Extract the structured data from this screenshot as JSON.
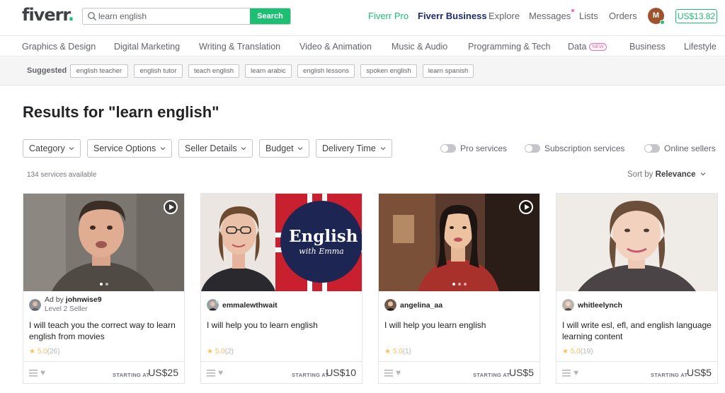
{
  "header": {
    "logo": "fiverr",
    "logo_dot": ".",
    "search_value": "learn english",
    "search_button": "Search",
    "nav": [
      "Fiverr Pro",
      "Fiverr Business",
      "Explore",
      "Messages",
      "Lists",
      "Orders"
    ],
    "avatar_initial": "M",
    "balance": "US$13.82"
  },
  "categories": [
    "Graphics & Design",
    "Digital Marketing",
    "Writing & Translation",
    "Video & Animation",
    "Music & Audio",
    "Programming & Tech",
    "Data",
    "Business",
    "Lifestyle"
  ],
  "new_badge": "NEW",
  "suggested": {
    "label": "Suggested",
    "tags": [
      "english teacher",
      "english tutor",
      "teach english",
      "learn arabic",
      "english lessons",
      "spoken english",
      "learn spanish"
    ]
  },
  "results_title": "Results for \"learn english\"",
  "filters": [
    "Category",
    "Service Options",
    "Seller Details",
    "Budget",
    "Delivery Time"
  ],
  "toggles": [
    "Pro services",
    "Subscription services",
    "Online sellers"
  ],
  "count": "134 services available",
  "sort": {
    "label": "Sort by",
    "value": "Relevance"
  },
  "thumb_overlay": {
    "english": "English",
    "with_emma": "with Emma"
  },
  "cards": [
    {
      "ad": "Ad by",
      "seller": "johnwise9",
      "level": "Level 2 Seller",
      "title": "I will teach you the correct way to learn english from movies",
      "rating": "5.0",
      "reviews": "(26)",
      "starting": "STARTING AT",
      "price": "US$25"
    },
    {
      "seller": "emmalewthwait",
      "title": "I will help you to learn english",
      "rating": "5.0",
      "reviews": "(2)",
      "starting": "STARTING AT",
      "price": "US$10"
    },
    {
      "seller": "angelina_aa",
      "title": "I will help you learn english",
      "rating": "5.0",
      "reviews": "(1)",
      "starting": "STARTING AT",
      "price": "US$5"
    },
    {
      "seller": "whitleelynch",
      "title": "I will write esl, efl, and english language learning content",
      "rating": "5.0",
      "reviews": "(19)",
      "starting": "STARTING AT",
      "price": "US$5"
    }
  ],
  "colors": {
    "brand_green": "#1dbf73",
    "business_navy": "#1d2a6c",
    "star": "#ffbe5b",
    "new_pink": "#ff62ad"
  }
}
